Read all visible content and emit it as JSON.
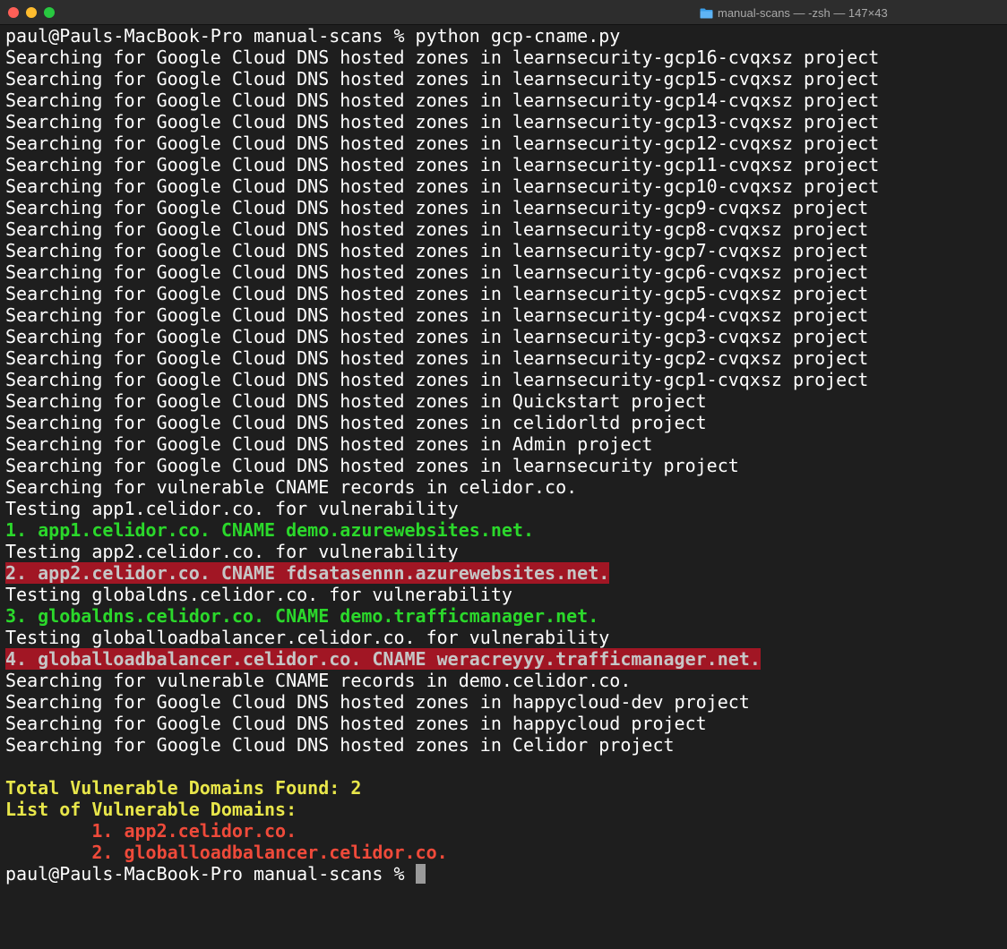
{
  "window": {
    "title": "manual-scans — -zsh — 147×43"
  },
  "terminal": {
    "lines": [
      {
        "text": "paul@Pauls-MacBook-Pro manual-scans % python gcp-cname.py",
        "style": "normal"
      },
      {
        "text": "Searching for Google Cloud DNS hosted zones in learnsecurity-gcp16-cvqxsz project",
        "style": "normal"
      },
      {
        "text": "Searching for Google Cloud DNS hosted zones in learnsecurity-gcp15-cvqxsz project",
        "style": "normal"
      },
      {
        "text": "Searching for Google Cloud DNS hosted zones in learnsecurity-gcp14-cvqxsz project",
        "style": "normal"
      },
      {
        "text": "Searching for Google Cloud DNS hosted zones in learnsecurity-gcp13-cvqxsz project",
        "style": "normal"
      },
      {
        "text": "Searching for Google Cloud DNS hosted zones in learnsecurity-gcp12-cvqxsz project",
        "style": "normal"
      },
      {
        "text": "Searching for Google Cloud DNS hosted zones in learnsecurity-gcp11-cvqxsz project",
        "style": "normal"
      },
      {
        "text": "Searching for Google Cloud DNS hosted zones in learnsecurity-gcp10-cvqxsz project",
        "style": "normal"
      },
      {
        "text": "Searching for Google Cloud DNS hosted zones in learnsecurity-gcp9-cvqxsz project",
        "style": "normal"
      },
      {
        "text": "Searching for Google Cloud DNS hosted zones in learnsecurity-gcp8-cvqxsz project",
        "style": "normal"
      },
      {
        "text": "Searching for Google Cloud DNS hosted zones in learnsecurity-gcp7-cvqxsz project",
        "style": "normal"
      },
      {
        "text": "Searching for Google Cloud DNS hosted zones in learnsecurity-gcp6-cvqxsz project",
        "style": "normal"
      },
      {
        "text": "Searching for Google Cloud DNS hosted zones in learnsecurity-gcp5-cvqxsz project",
        "style": "normal"
      },
      {
        "text": "Searching for Google Cloud DNS hosted zones in learnsecurity-gcp4-cvqxsz project",
        "style": "normal"
      },
      {
        "text": "Searching for Google Cloud DNS hosted zones in learnsecurity-gcp3-cvqxsz project",
        "style": "normal"
      },
      {
        "text": "Searching for Google Cloud DNS hosted zones in learnsecurity-gcp2-cvqxsz project",
        "style": "normal"
      },
      {
        "text": "Searching for Google Cloud DNS hosted zones in learnsecurity-gcp1-cvqxsz project",
        "style": "normal"
      },
      {
        "text": "Searching for Google Cloud DNS hosted zones in Quickstart project",
        "style": "normal"
      },
      {
        "text": "Searching for Google Cloud DNS hosted zones in celidorltd project",
        "style": "normal"
      },
      {
        "text": "Searching for Google Cloud DNS hosted zones in Admin project",
        "style": "normal"
      },
      {
        "text": "Searching for Google Cloud DNS hosted zones in learnsecurity project",
        "style": "normal"
      },
      {
        "text": "Searching for vulnerable CNAME records in celidor.co.",
        "style": "normal"
      },
      {
        "text": "Testing app1.celidor.co. for vulnerability",
        "style": "normal"
      },
      {
        "text": "1. app1.celidor.co. CNAME demo.azurewebsites.net.",
        "style": "green"
      },
      {
        "text": "Testing app2.celidor.co. for vulnerability",
        "style": "normal"
      },
      {
        "text": "2. app2.celidor.co. CNAME fdsatasennn.azurewebsites.net.",
        "style": "hl"
      },
      {
        "text": "Testing globaldns.celidor.co. for vulnerability",
        "style": "normal"
      },
      {
        "text": "3. globaldns.celidor.co. CNAME demo.trafficmanager.net.",
        "style": "green"
      },
      {
        "text": "Testing globalloadbalancer.celidor.co. for vulnerability",
        "style": "normal"
      },
      {
        "text": "4. globalloadbalancer.celidor.co. CNAME weracreyyy.trafficmanager.net.",
        "style": "hl"
      },
      {
        "text": "Searching for vulnerable CNAME records in demo.celidor.co.",
        "style": "normal"
      },
      {
        "text": "Searching for Google Cloud DNS hosted zones in happycloud-dev project",
        "style": "normal"
      },
      {
        "text": "Searching for Google Cloud DNS hosted zones in happycloud project",
        "style": "normal"
      },
      {
        "text": "Searching for Google Cloud DNS hosted zones in Celidor project",
        "style": "normal"
      },
      {
        "text": "",
        "style": "normal"
      },
      {
        "text": "Total Vulnerable Domains Found: 2",
        "style": "yellow"
      },
      {
        "text": "List of Vulnerable Domains:",
        "style": "yellow"
      },
      {
        "text": "        1. app2.celidor.co.",
        "style": "red"
      },
      {
        "text": "        2. globalloadbalancer.celidor.co.",
        "style": "red"
      }
    ],
    "prompt": "paul@Pauls-MacBook-Pro manual-scans % "
  },
  "colors": {
    "background": "#1e1e1e",
    "normal": "#ffffff",
    "green": "#2bd82b",
    "highlight_bg": "#a11624",
    "yellow": "#e8e64a",
    "red": "#ef4a3a"
  },
  "icons": {
    "title_icon": "folder-icon",
    "close": "close-window-button",
    "minimize": "minimize-window-button",
    "zoom": "zoom-window-button"
  }
}
